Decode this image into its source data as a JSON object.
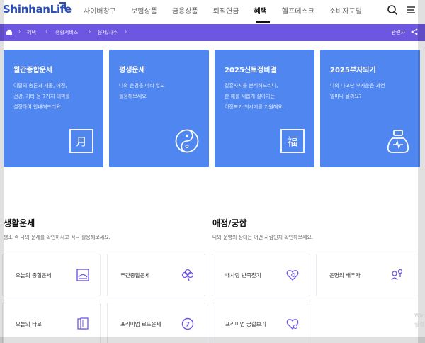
{
  "header": {
    "logo": "ShinhanLife",
    "nav": [
      {
        "label": "사이버창구",
        "active": false
      },
      {
        "label": "보험상품",
        "active": false
      },
      {
        "label": "금융상품",
        "active": false
      },
      {
        "label": "퇴직연금",
        "active": false
      },
      {
        "label": "혜택",
        "active": true
      },
      {
        "label": "헬프데스크",
        "active": false
      },
      {
        "label": "소비자포털",
        "active": false
      }
    ],
    "icons": [
      "search-icon",
      "menu-icon"
    ]
  },
  "breadcrumb": {
    "items": [
      "혜택",
      "생활서비스",
      "운세/사주"
    ],
    "right_label": "관련사"
  },
  "cards": [
    {
      "title": "월간종합운세",
      "desc": [
        "이달의 총론과 재물, 애정,",
        "건강, 기타 등 7가지 테마를",
        "설정하여 안내해드리요."
      ],
      "icon": "moon-calendar-icon",
      "glyph": "月"
    },
    {
      "title": "평생운세",
      "desc": [
        "나의 운명을 미리 알고",
        "활용해보세요."
      ],
      "icon": "yin-yang-icon",
      "glyph": ""
    },
    {
      "title": "2025신토정비결",
      "desc": [
        "길흉사시를 분석해드리니,",
        "한 해를 새롭게 살아가는",
        "이정표가 되시기를 기원해요."
      ],
      "icon": "fortune-icon",
      "glyph": "福"
    },
    {
      "title": "2025부자되기",
      "desc": [
        "나의 나고난 부자운은 과연",
        "얼마나 될까요?"
      ],
      "icon": "money-bag-icon",
      "glyph": ""
    }
  ],
  "sections": [
    {
      "title": "생활운세",
      "desc": "평소 속 나의 운세를 확인하시고 적극 활용해보세요.",
      "items": [
        {
          "label": "오늘의 종합운세",
          "icon": "sunrise-icon"
        },
        {
          "label": "주간종합운세",
          "icon": "clover-icon"
        },
        {
          "label": "오늘의 타로",
          "icon": "tarot-cards-icon"
        },
        {
          "label": "프리미엄 로또운세",
          "icon": "lotto-ball-icon"
        }
      ]
    },
    {
      "title": "애정/궁합",
      "desc": "나와 운명의 상대는 어떤 사람인지 확인해보세요.",
      "items": [
        {
          "label": "내사랑 반쪽찾기",
          "icon": "heart-search-icon"
        },
        {
          "label": "운명의 배우자",
          "icon": "couple-icon"
        },
        {
          "label": "프리미엄 궁합보기",
          "icon": "heart-link-icon"
        }
      ]
    }
  ],
  "colors": {
    "brand": "#2b4fb8",
    "crumb_bar": "#6e57e0",
    "card": "#4f86ef",
    "icon_accent": "#6e57e0"
  },
  "watermark": [
    "Win",
    "설정"
  ]
}
